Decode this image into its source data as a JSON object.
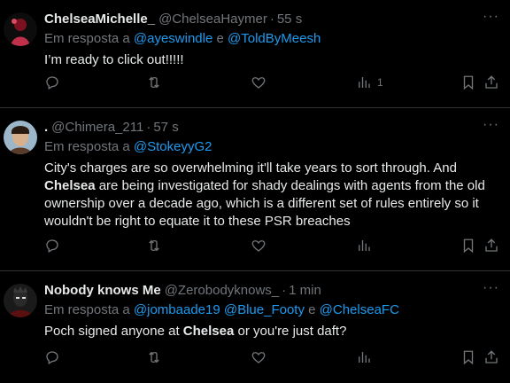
{
  "tweets": [
    {
      "name": "ChelseaMichelle_",
      "handle": "@ChelseaHaymer",
      "separator": "·",
      "time": "55 s",
      "reply_prefix": "Em resposta a",
      "mentions": [
        "@ayeswindle",
        "@ToldByMeesh"
      ],
      "mention_joiner": "e",
      "text_parts": [
        {
          "t": "I’m ready to click out!!!!!",
          "b": false
        }
      ],
      "views": "1",
      "avatar_colors": [
        "#7a1020",
        "#c0304a"
      ]
    },
    {
      "name": ".",
      "handle": "@Chimera_211",
      "separator": "·",
      "time": "57 s",
      "reply_prefix": "Em resposta a",
      "mentions": [
        "@StokeyyG2"
      ],
      "mention_joiner": "",
      "text_parts": [
        {
          "t": "City's charges are so overwhelming it'll take years to sort through. And ",
          "b": false
        },
        {
          "t": "Chelsea",
          "b": true
        },
        {
          "t": " are being investigated for shady dealings with agents from the old ownership over a decade ago, which is a different set of rules entirely so it wouldn't be right to equate it to these PSR breaches",
          "b": false
        }
      ],
      "views": "",
      "avatar_colors": [
        "#9bb7c9",
        "#5a3b2a"
      ]
    },
    {
      "name": "Nobody knows Me",
      "handle": "@Zerobodyknows_",
      "separator": "·",
      "time": "1 min",
      "reply_prefix": "Em resposta a",
      "mentions": [
        "@jombaade19",
        "@Blue_Footy",
        "@ChelseaFC"
      ],
      "mention_joiner": "e",
      "text_parts": [
        {
          "t": "Poch signed anyone at ",
          "b": false
        },
        {
          "t": "Chelsea",
          "b": true
        },
        {
          "t": " or you're just daft?",
          "b": false
        }
      ],
      "views": "",
      "avatar_colors": [
        "#2a2a2a",
        "#5a1010"
      ]
    }
  ],
  "icons": [
    "reply-icon",
    "retweet-icon",
    "like-icon",
    "views-icon",
    "bookmark-icon",
    "share-icon"
  ],
  "colors": {
    "background": "#000000",
    "text": "#e7e9ea",
    "muted": "#71767b",
    "link": "#1d9bf0",
    "divider": "#2f3336"
  }
}
